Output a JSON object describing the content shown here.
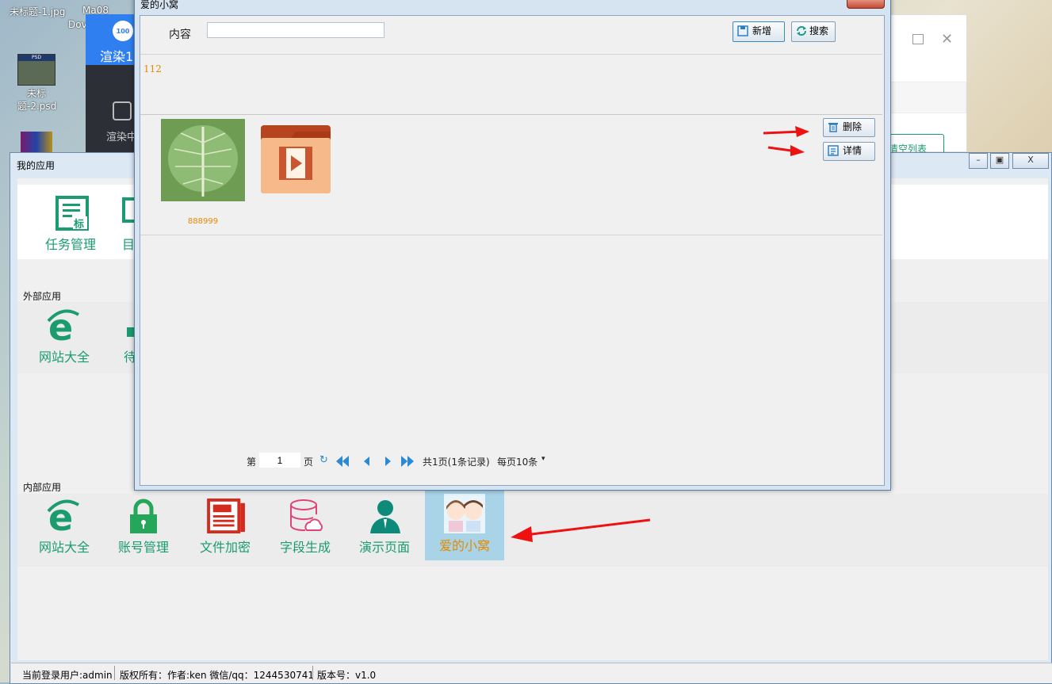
{
  "desktop": {
    "top_files": [
      "未标题-1.jpg",
      "Ma08",
      "Dov"
    ],
    "icon_psd_label": "未标题-2.psd",
    "icon_psd_badge": "PSD"
  },
  "bg_app": {
    "logo_text": "100",
    "title": "渲染1",
    "item": "渲染中"
  },
  "bg_window": {
    "link_text": "清空列表"
  },
  "main_window": {
    "title": "我的应用",
    "controls": [
      "–",
      "▣",
      "X"
    ],
    "top_apps": [
      {
        "label": "任务管理",
        "icon": "doc-list-icon"
      },
      {
        "label": "目",
        "icon": "monitor-icon"
      }
    ],
    "external": {
      "title": "外部应用",
      "apps": [
        {
          "label": "网站大全",
          "icon": "ie-icon"
        },
        {
          "label": "待",
          "icon": "pc-icon"
        }
      ]
    },
    "internal": {
      "title": "内部应用",
      "apps": [
        {
          "label": "网站大全",
          "icon": "ie-icon"
        },
        {
          "label": "账号管理",
          "icon": "lock-icon"
        },
        {
          "label": "文件加密",
          "icon": "file-icon"
        },
        {
          "label": "字段生成",
          "icon": "db-cloud-icon"
        },
        {
          "label": "演示页面",
          "icon": "user-icon"
        },
        {
          "label": "爱的小窝",
          "icon": "couple-icon"
        }
      ]
    }
  },
  "status_bar": {
    "user": "当前登录用户:admin",
    "copyright": "版权所有：作者:ken 微信/qq：1244530741",
    "version": "版本号：v1.0"
  },
  "dialog": {
    "title": "爱的小窝",
    "search_label": "内容",
    "search_value": "",
    "add_label": "新增",
    "search_btn_label": "搜索",
    "record_text": "112",
    "image_caption": "888999",
    "delete_label": "删除",
    "detail_label": "详情",
    "pager": {
      "prefix": "第",
      "page": "1",
      "suffix": "页",
      "total": "共1页(1条记录)",
      "per_page": "每页10条"
    }
  },
  "colors": {
    "accent_green": "#1a9c6e",
    "orange_text": "#e58a00",
    "selected_tile": "#a9d4e8",
    "arrow_red": "#ee1111"
  }
}
